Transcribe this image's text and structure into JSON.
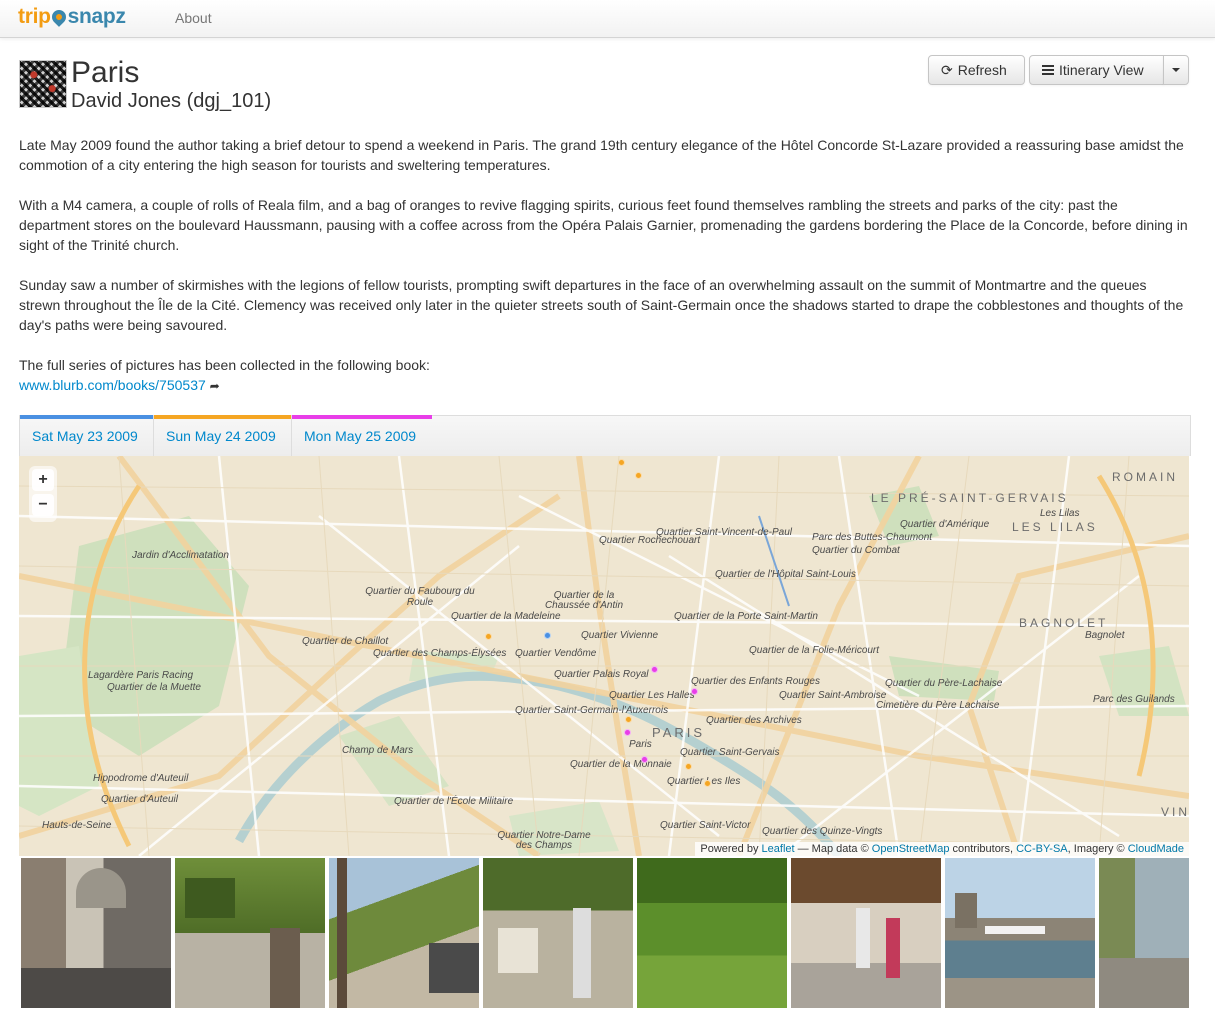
{
  "navbar": {
    "brand_trip": "trip",
    "brand_snapz": "snapz",
    "about": "About"
  },
  "header": {
    "title": "Paris",
    "subtitle": "David Jones (dgj_101)"
  },
  "buttons": {
    "refresh": "Refresh",
    "refresh_icon": "refresh-icon",
    "itinerary": "Itinerary View",
    "itinerary_icon": "list-icon"
  },
  "intro": {
    "p1": "Late May 2009 found the author taking a brief detour to spend a weekend in Paris. The grand 19th century elegance of the Hôtel Concorde St-Lazare provided a reassuring base amidst the commotion of a city entering the high season for tourists and sweltering temperatures.",
    "p2": "With a M4 camera, a couple of rolls of Reala film, and a bag of oranges to revive flagging spirits, curious feet found themselves rambling the streets and parks of the city: past the department stores on the boulevard Haussmann, pausing with a coffee across from the Opéra Palais Garnier, promenading the gardens bordering the Place de la Concorde, before dining in sight of the Trinité church.",
    "p3": "Sunday saw a number of skirmishes with the legions of fellow tourists, prompting swift departures in the face of an overwhelming assault on the summit of Montmartre and the queues strewn throughout the Île de la Cité. Clemency was received only later in the quieter streets south of Saint-Germain once the shadows started to drape the cobblestones and thoughts of the day's paths were being savoured.",
    "p4": "The full series of pictures has been collected in the following book:",
    "link": "www.blurb.com/books/750537",
    "link_icon": "share-arrow-icon"
  },
  "tabs": [
    {
      "label": "Sat May 23 2009",
      "color": "#4a90e2"
    },
    {
      "label": "Sun May 24 2009",
      "color": "#f5a623"
    },
    {
      "label": "Mon May 25 2009",
      "color": "#e83ee8"
    }
  ],
  "map": {
    "zoom_in": "+",
    "zoom_out": "−",
    "labels": [
      "Jardin d'Acclimatation",
      "Quartier Rochechouart",
      "Quartier Saint-Vincent-de-Paul",
      "Parc des Buttes-Chaumont",
      "Quartier d'Amérique",
      "Quartier du Combat",
      "Quartier de l'Hôpital Saint-Louis",
      "Quartier du Faubourg du Roule",
      "Quartier de la Chaussée d'Antin",
      "Quartier de la Madeleine",
      "Quartier de la Porte Saint-Martin",
      "Quartier de Chaillot",
      "Quartier Vivienne",
      "Quartier des Champs-Élysées",
      "Quartier Vendôme",
      "Quartier de la Folie-Méricourt",
      "Quartier Palais Royal",
      "Lagardère Paris Racing",
      "Quartier de la Muette",
      "Quartier des Enfants Rouges",
      "Quartier du Père-Lachaise",
      "Quartier Les Halles",
      "Quartier Saint-Ambroise",
      "Cimetière du Père Lachaise",
      "Quartier Saint-Germain-l'Auxerrois",
      "Parc des Guilands",
      "Quartier des Archives",
      "Paris",
      "Quartier Saint-Gervais",
      "Champ de Mars",
      "Quartier de la Monnaie",
      "Hippodrome d'Auteuil",
      "Quartier Les Iles",
      "Quartier d'Auteuil",
      "Quartier de l'École Militaire",
      "Hauts-de-Seine",
      "Quartier Saint-Victor",
      "Quartier des Quinze-Vingts",
      "Quartier Notre-Dame des Champs",
      "Les Lilas",
      "Bagnolet"
    ],
    "big_labels": [
      "LE PRÉ-SAINT-GERVAIS",
      "LES LILAS",
      "BAGNOLET",
      "PARIS",
      "ROMAIN",
      "VINC"
    ],
    "attribution": {
      "powered": "Powered by",
      "leaflet": "Leaflet",
      "mapdata": "— Map data ©",
      "osm": "OpenStreetMap",
      "contrib": "contributors,",
      "license": "CC-BY-SA",
      "imagery": ", Imagery ©",
      "cloudmade": "CloudMade"
    }
  },
  "photos": [
    "street-with-dome-photo",
    "ivy-covered-building-photo",
    "montmartre-stairs-photo",
    "park-kiosk-photo",
    "garden-hedge-photo",
    "market-stall-photo",
    "notre-dame-seine-photo",
    "seine-quay-photo"
  ]
}
